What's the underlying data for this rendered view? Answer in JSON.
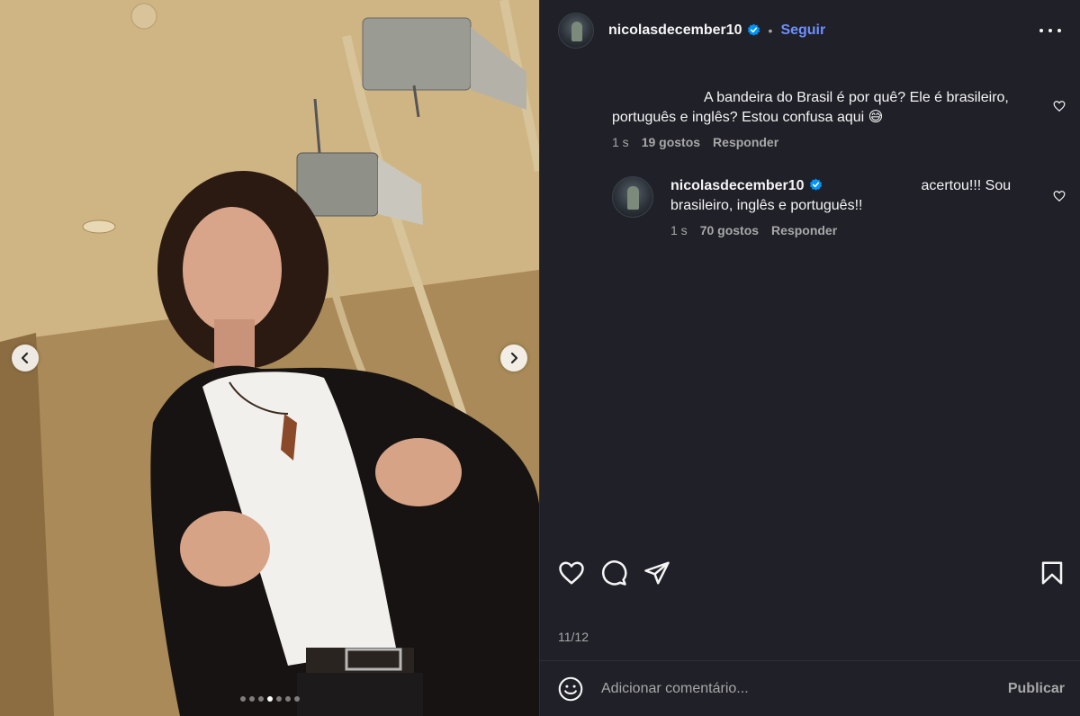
{
  "post": {
    "username": "nicolasdecember10",
    "separator": "•",
    "follow_label": "Seguir",
    "carousel": {
      "total": 7,
      "active_index": 3
    }
  },
  "comments": [
    {
      "text": "A bandeira do Brasil é por quê? Ele é brasileiro, português e inglês? Estou confusa aqui 😅",
      "time": "1 s",
      "likes": "19 gostos",
      "reply_label": "Responder"
    },
    {
      "username": "nicolasdecember10",
      "text": "acertou!!! Sou brasileiro, inglês e português!!",
      "time": "1 s",
      "likes": "70 gostos",
      "reply_label": "Responder"
    }
  ],
  "actions": {
    "icons": [
      "heart-icon",
      "comment-icon",
      "share-icon",
      "bookmark-icon"
    ],
    "counter": "11/12"
  },
  "composer": {
    "placeholder": "Adicionar comentário...",
    "publish_label": "Publicar"
  },
  "colors": {
    "panel_bg": "#1f2028",
    "link_blue": "#6e8fff",
    "verified_blue": "#0095f6",
    "secondary_text": "#a8a8a8"
  }
}
